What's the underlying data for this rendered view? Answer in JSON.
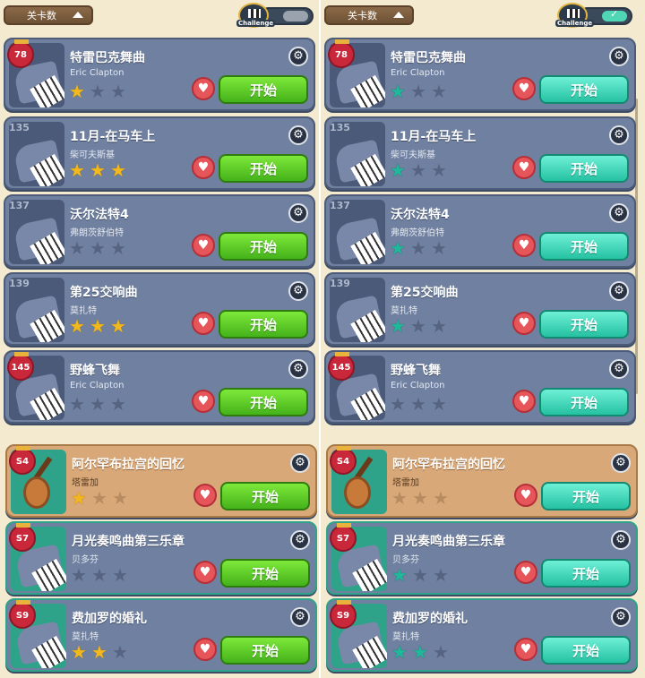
{
  "left": {
    "dropdown_label": "关卡数",
    "challenge_label": "Challenge",
    "challenge_enabled": false,
    "songs": [
      {
        "level": "78",
        "title": "特雷巴克舞曲",
        "composer": "Eric Clapton",
        "stars": 1,
        "badge": true,
        "instrument": "piano"
      },
      {
        "level": "135",
        "title": "11月-在马车上",
        "composer": "柴可夫斯基",
        "stars": 3,
        "badge": false,
        "instrument": "piano"
      },
      {
        "level": "137",
        "title": "沃尔法特4",
        "composer": "弗朗茨舒伯特",
        "stars": 0,
        "badge": false,
        "instrument": "piano"
      },
      {
        "level": "139",
        "title": "第25交响曲",
        "composer": "莫扎特",
        "stars": 3,
        "badge": false,
        "instrument": "piano"
      },
      {
        "level": "145",
        "title": "野蜂飞舞",
        "composer": "Eric Clapton",
        "stars": 0,
        "badge": true,
        "instrument": "piano"
      },
      {
        "level": "S4",
        "title": "阿尔罕布拉宫的回忆",
        "composer": "塔雷加",
        "stars": 1,
        "badge": true,
        "instrument": "guitar",
        "special": true
      },
      {
        "level": "S7",
        "title": "月光奏鸣曲第三乐章",
        "composer": "贝多芬",
        "stars": 0,
        "badge": true,
        "instrument": "piano",
        "teal_frame": true
      },
      {
        "level": "S9",
        "title": "费加罗的婚礼",
        "composer": "莫扎特",
        "stars": 2,
        "badge": true,
        "instrument": "piano",
        "teal_frame": true
      }
    ],
    "start_label": "开始",
    "star_color": "gold",
    "button_color": "green"
  },
  "right": {
    "dropdown_label": "关卡数",
    "challenge_label": "Challenge",
    "challenge_enabled": true,
    "songs": [
      {
        "level": "78",
        "title": "特雷巴克舞曲",
        "composer": "Eric Clapton",
        "stars": 1,
        "badge": true,
        "instrument": "piano"
      },
      {
        "level": "135",
        "title": "11月-在马车上",
        "composer": "柴可夫斯基",
        "stars": 1,
        "badge": false,
        "instrument": "piano"
      },
      {
        "level": "137",
        "title": "沃尔法特4",
        "composer": "弗朗茨舒伯特",
        "stars": 1,
        "badge": false,
        "instrument": "piano"
      },
      {
        "level": "139",
        "title": "第25交响曲",
        "composer": "莫扎特",
        "stars": 1,
        "badge": false,
        "instrument": "piano"
      },
      {
        "level": "145",
        "title": "野蜂飞舞",
        "composer": "Eric Clapton",
        "stars": 0,
        "badge": true,
        "instrument": "piano"
      },
      {
        "level": "S4",
        "title": "阿尔罕布拉宫的回忆",
        "composer": "塔雷加",
        "stars": 0,
        "badge": true,
        "instrument": "guitar",
        "special": true
      },
      {
        "level": "S7",
        "title": "月光奏鸣曲第三乐章",
        "composer": "贝多芬",
        "stars": 1,
        "badge": true,
        "instrument": "piano",
        "teal_frame": true
      },
      {
        "level": "S9",
        "title": "费加罗的婚礼",
        "composer": "莫扎特",
        "stars": 2,
        "badge": true,
        "instrument": "piano",
        "teal_frame": true
      }
    ],
    "start_label": "开始",
    "star_color": "teal",
    "button_color": "teal"
  },
  "icons": {
    "settings": "gear-icon",
    "favorite": "heart-icon",
    "star": "star-icon",
    "dropdown": "caret-up-icon",
    "challenge": "checkered-flag-icon"
  }
}
